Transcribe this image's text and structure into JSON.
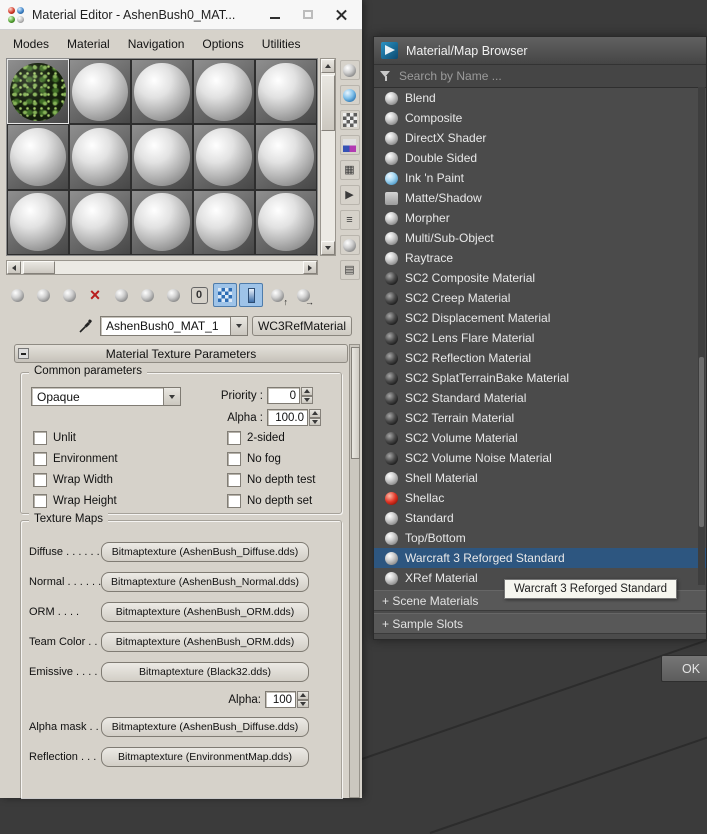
{
  "window": {
    "title": "Material Editor - AshenBush0_MAT..."
  },
  "menu": {
    "items": [
      "Modes",
      "Material",
      "Navigation",
      "Options",
      "Utilities"
    ]
  },
  "editor": {
    "side_toolbar_icons": [
      "sample-type",
      "backlight",
      "background",
      "sample-uv-tiling",
      "video-color-check",
      "make-preview",
      "options",
      "select-by-material",
      "material-map-navigator"
    ],
    "toolbar_icons": [
      "get-material",
      "put-material-to-scene",
      "assign-material-to-selection",
      "reset-map-mtl-to-default",
      "make-material-copy",
      "make-unique",
      "put-to-library",
      "material-id-channel",
      "show-shaded-material-in-viewport",
      "show-end-result",
      "go-to-parent",
      "go-forward-to-sibling"
    ],
    "material_name": "AshenBush0_MAT_1",
    "material_type": "WC3RefMaterial",
    "rollout": "Material Texture Parameters",
    "common": {
      "title": "Common parameters",
      "blend_mode": "Opaque",
      "priority_label": "Priority :",
      "priority_value": "0",
      "alpha_label": "Alpha :",
      "alpha_value": "100.0",
      "checkboxes_left": [
        "Unlit",
        "Environment",
        "Wrap Width",
        "Wrap Height"
      ],
      "checkboxes_right": [
        "2-sided",
        "No fog",
        "No depth test",
        "No depth set"
      ]
    },
    "textures": {
      "title": "Texture Maps",
      "rows": [
        {
          "type": "map",
          "label": "Diffuse . . . . . .",
          "button": "Bitmaptexture (AshenBush_Diffuse.dds)"
        },
        {
          "type": "map",
          "label": "Normal . . . . . .",
          "button": "Bitmaptexture (AshenBush_Normal.dds)"
        },
        {
          "type": "map",
          "label": "ORM . . . .",
          "button": "Bitmaptexture (AshenBush_ORM.dds)"
        },
        {
          "type": "map",
          "label": "Team Color . .",
          "button": "Bitmaptexture (AshenBush_ORM.dds)"
        },
        {
          "type": "map",
          "label": "Emissive . . . .",
          "button": "Bitmaptexture (Black32.dds)"
        },
        {
          "type": "spinner",
          "label": "Alpha:",
          "value": "100"
        },
        {
          "type": "map",
          "label": "Alpha mask . .",
          "button": "Bitmaptexture (AshenBush_Diffuse.dds)"
        },
        {
          "type": "map",
          "label": "Reflection . . .",
          "button": "Bitmaptexture (EnvironmentMap.dds)"
        }
      ]
    }
  },
  "browser": {
    "title": "Material/Map Browser",
    "search_placeholder": "Search by Name ...",
    "items": [
      {
        "label": "Blend",
        "icon": "gray"
      },
      {
        "label": "Composite",
        "icon": "gray"
      },
      {
        "label": "DirectX Shader",
        "icon": "gray"
      },
      {
        "label": "Double Sided",
        "icon": "gray"
      },
      {
        "label": "Ink 'n Paint",
        "icon": "blue"
      },
      {
        "label": "Matte/Shadow",
        "icon": "flat"
      },
      {
        "label": "Morpher",
        "icon": "gray"
      },
      {
        "label": "Multi/Sub-Object",
        "icon": "gray"
      },
      {
        "label": "Raytrace",
        "icon": "gray"
      },
      {
        "label": "SC2 Composite Material",
        "icon": "dark"
      },
      {
        "label": "SC2 Creep Material",
        "icon": "dark"
      },
      {
        "label": "SC2 Displacement Material",
        "icon": "dark"
      },
      {
        "label": "SC2 Lens Flare Material",
        "icon": "dark"
      },
      {
        "label": "SC2 Reflection Material",
        "icon": "dark"
      },
      {
        "label": "SC2 SplatTerrainBake Material",
        "icon": "dark"
      },
      {
        "label": "SC2 Standard Material",
        "icon": "dark"
      },
      {
        "label": "SC2 Terrain Material",
        "icon": "dark"
      },
      {
        "label": "SC2 Volume Material",
        "icon": "dark"
      },
      {
        "label": "SC2 Volume Noise Material",
        "icon": "dark"
      },
      {
        "label": "Shell Material",
        "icon": "gray"
      },
      {
        "label": "Shellac",
        "icon": "red"
      },
      {
        "label": "Standard",
        "icon": "gray"
      },
      {
        "label": "Top/Bottom",
        "icon": "gray"
      },
      {
        "label": "Warcraft 3 Reforged Standard",
        "icon": "gray",
        "selected": true
      },
      {
        "label": "XRef Material",
        "icon": "gray"
      }
    ],
    "groups": [
      "+ Scene Materials",
      "+ Sample Slots"
    ],
    "ok_label": "OK",
    "tooltip": "Warcraft 3 Reforged Standard"
  }
}
